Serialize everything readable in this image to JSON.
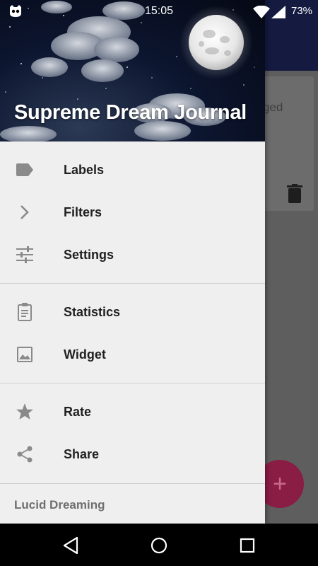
{
  "status_bar": {
    "time": "15:05",
    "battery": "73%",
    "icons": [
      "cyanogen-cat-icon",
      "wifi-icon",
      "cell-signal-icon"
    ]
  },
  "background": {
    "card_text": "ged",
    "fab_symbol": "+"
  },
  "drawer": {
    "title": "Supreme Dream Journal",
    "sections": [
      [
        {
          "label": "Labels",
          "icon": "label-tag-icon"
        },
        {
          "label": "Filters",
          "icon": "chevron-right-icon"
        },
        {
          "label": "Settings",
          "icon": "sliders-icon"
        }
      ],
      [
        {
          "label": "Statistics",
          "icon": "clipboard-icon"
        },
        {
          "label": "Widget",
          "icon": "image-icon"
        }
      ],
      [
        {
          "label": "Rate",
          "icon": "star-icon"
        },
        {
          "label": "Share",
          "icon": "share-icon"
        }
      ]
    ],
    "footer": "Lucid Dreaming"
  },
  "nav_bar": {
    "buttons": [
      "back-icon",
      "home-icon",
      "recents-icon"
    ]
  },
  "colors": {
    "toolbar": "#141a40",
    "fab": "#8a1d43",
    "drawer_bg": "#efefef",
    "icon_gray": "#8a8a8a"
  }
}
